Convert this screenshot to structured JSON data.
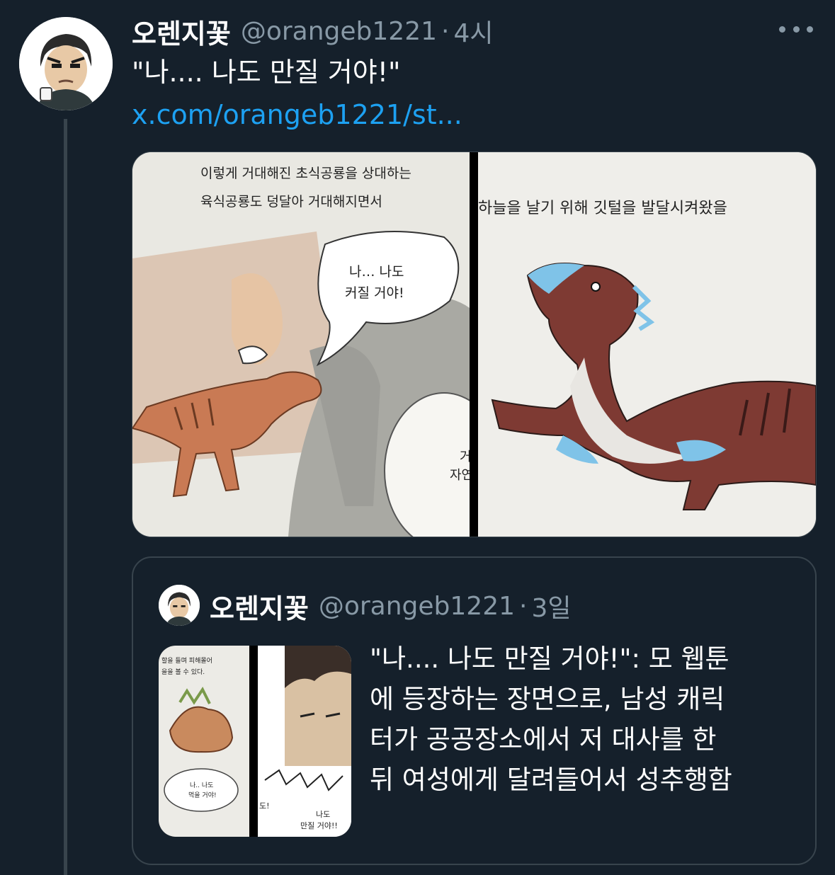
{
  "tweet": {
    "author_name": "오렌지꽃",
    "handle": "@orangeb1221",
    "separator": "·",
    "time": "4시",
    "text": "\"나.... 나도 만질 거야!\"",
    "link": "x.com/orangeb1221/st...",
    "media": {
      "left_panel": {
        "caption_line1": "이렇게 거대해진 초식공룡을 상대하는",
        "caption_line2": "육식공룡도 덩달아 거대해지면서",
        "bubble_line1": "나… 나도",
        "bubble_line2": "커질 거야!",
        "partial_line1": "거",
        "partial_line2": "자연"
      },
      "right_panel": {
        "caption": "하늘을 날기 위해 깃털을 발달시켜왔을"
      }
    }
  },
  "quoted_tweet": {
    "author_name": "오렌지꽃",
    "handle": "@orangeb1221",
    "separator": "·",
    "time": "3일",
    "text_lines": [
      "\"나.... 나도 만질 거야!\": 모 웹툰",
      "에 등장하는 장면으로, 남성 캐릭",
      "터가 공공장소에서 저 대사를 한",
      "뒤 여성에게 달려들어서 성추행함"
    ],
    "thumbnail": {
      "left_top1": "할을 들며 피해몰어",
      "left_top2": "을을 볼 수 있다.",
      "left_bubble1": "나.. 나도",
      "left_bubble2": "먹을 거야!",
      "right_bubble1": "나도",
      "right_bubble2": "만질 거야!!",
      "right_partial": "도!"
    }
  },
  "colors": {
    "background": "#15202b",
    "secondary_text": "#8899a6",
    "link": "#1da1f2",
    "border": "#38444d"
  },
  "icons": [
    "more-icon"
  ]
}
